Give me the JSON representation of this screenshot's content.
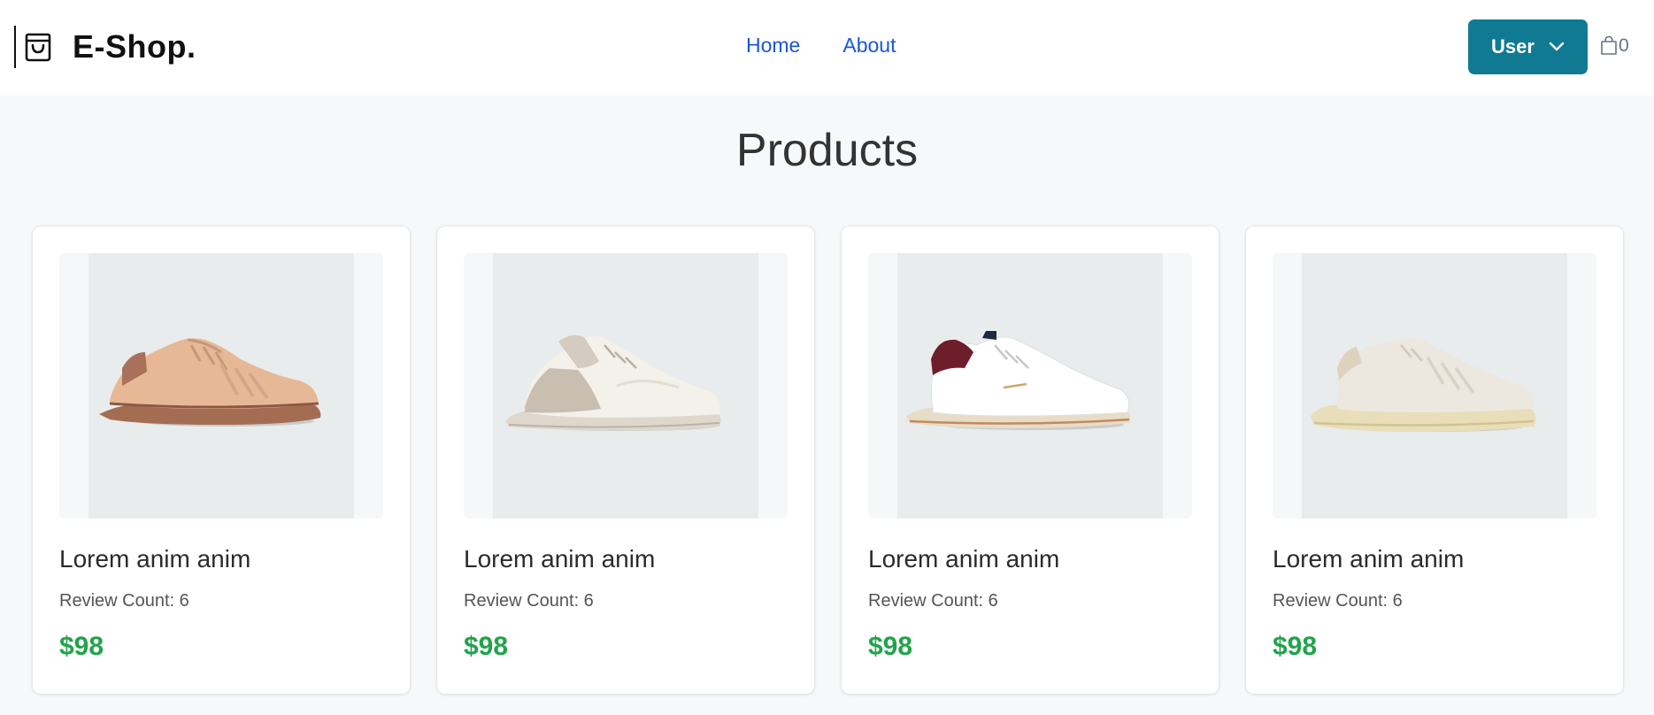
{
  "brand": {
    "name": "E-Shop."
  },
  "nav": {
    "home": "Home",
    "about": "About"
  },
  "user_menu": {
    "label": "User"
  },
  "cart": {
    "count": "0"
  },
  "page": {
    "title": "Products"
  },
  "products": [
    {
      "name": "Lorem anim anim",
      "reviews": "Review Count: 6",
      "price": "$98",
      "image": "tan-suede-sneaker"
    },
    {
      "name": "Lorem anim anim",
      "reviews": "Review Count: 6",
      "price": "$98",
      "image": "white-speckled-sneaker"
    },
    {
      "name": "Lorem anim anim",
      "reviews": "Review Count: 6",
      "price": "$98",
      "image": "white-burgundy-sneaker"
    },
    {
      "name": "Lorem anim anim",
      "reviews": "Review Count: 6",
      "price": "$98",
      "image": "cream-suede-sneaker"
    }
  ],
  "colors": {
    "accent": "#117a93",
    "link": "#1a56d8",
    "price": "#22a34b",
    "background": "#f7f8fa"
  }
}
